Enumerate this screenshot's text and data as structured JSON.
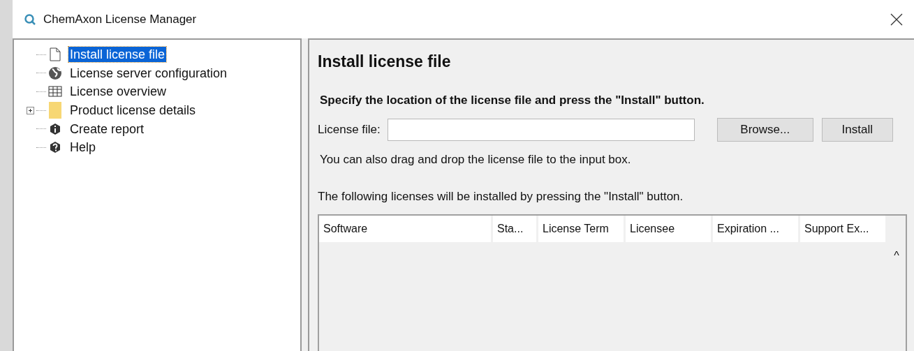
{
  "window": {
    "title": "ChemAxon License Manager"
  },
  "tree": {
    "items": [
      {
        "label": "Install license file",
        "kind": "file",
        "selected": true,
        "collapsed": false
      },
      {
        "label": "License server configuration",
        "kind": "globe",
        "selected": false,
        "collapsed": false
      },
      {
        "label": "License overview",
        "kind": "grid",
        "selected": false,
        "collapsed": false
      },
      {
        "label": "Product license details",
        "kind": "folder",
        "selected": false,
        "collapsed": true
      },
      {
        "label": "Create report",
        "kind": "info",
        "selected": false,
        "collapsed": false
      },
      {
        "label": "Help",
        "kind": "help",
        "selected": false,
        "collapsed": false
      }
    ]
  },
  "panel": {
    "title": "Install license file",
    "instruction": "Specify the location of the license file and press the \"Install\" button.",
    "field_label": "License file:",
    "browse_button": "Browse...",
    "install_button": "Install",
    "hint": "You can also drag and drop the license file to the input box.",
    "table_caption": "The following licenses will be installed by pressing the \"Install\" button.",
    "table": {
      "columns": [
        "Software",
        "Sta...",
        "License Term",
        "Licensee",
        "Expiration ...",
        "Support Ex..."
      ],
      "scroll_glyph": "^"
    }
  }
}
